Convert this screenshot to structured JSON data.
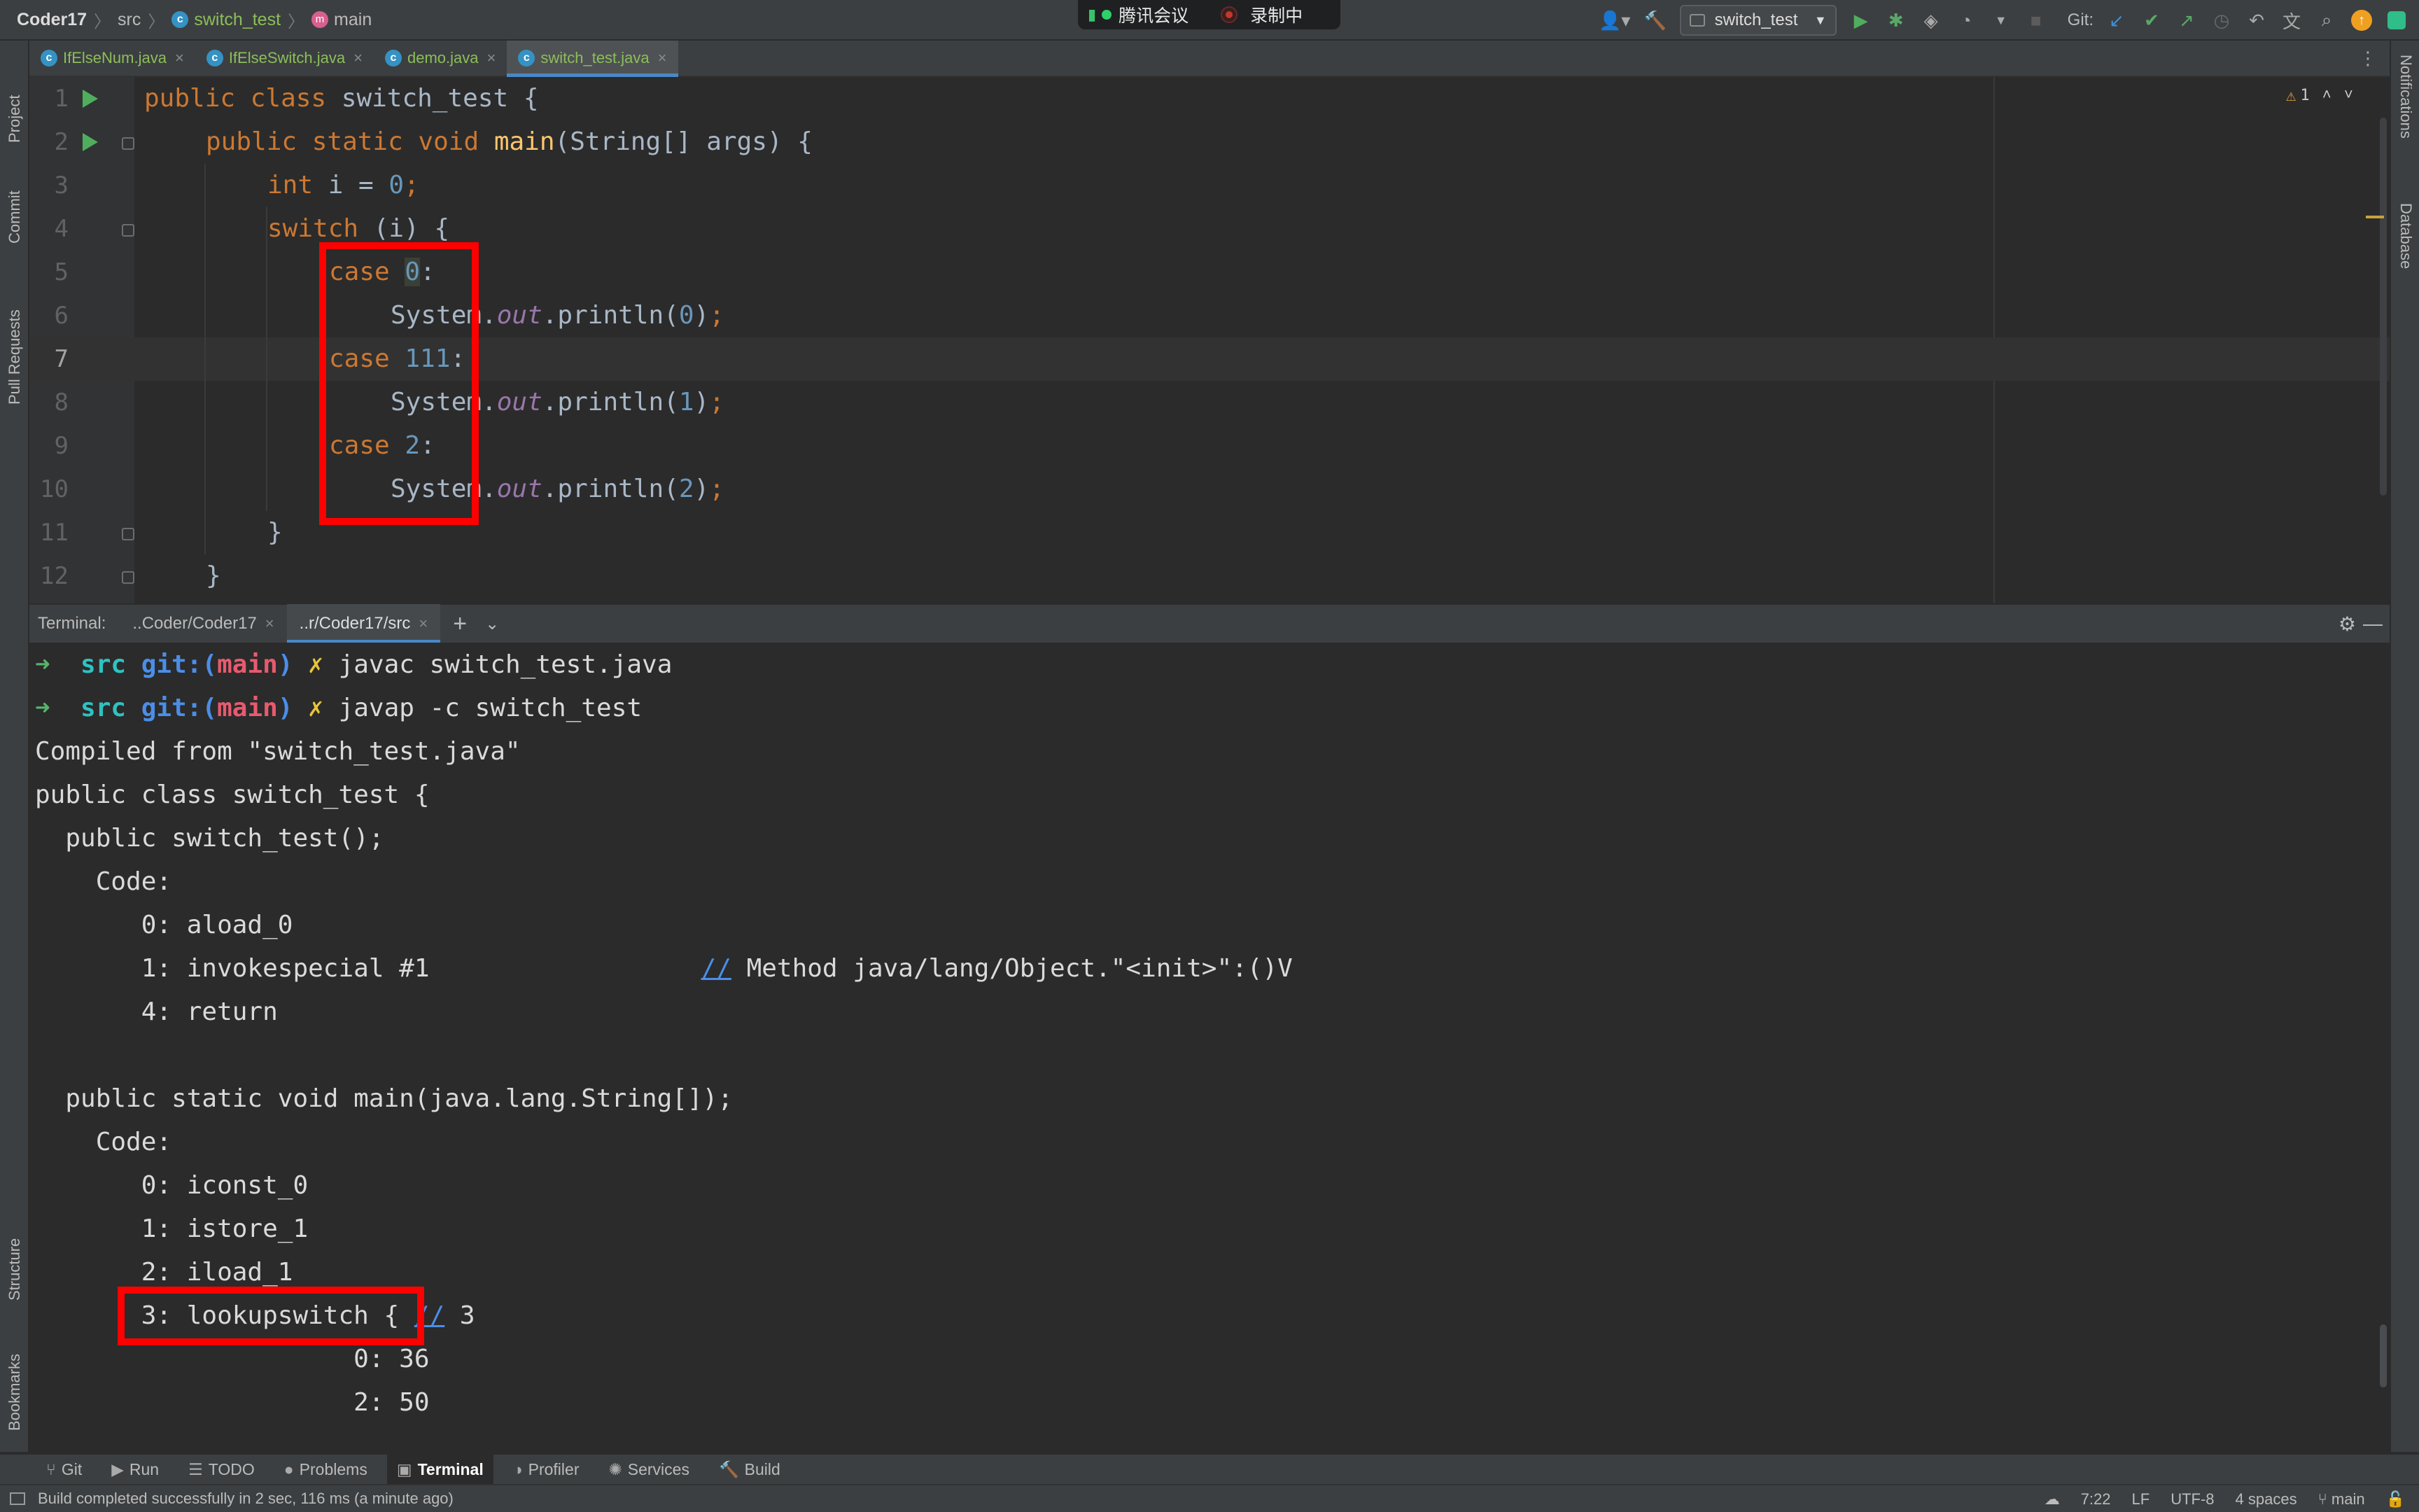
{
  "breadcrumb": {
    "project": "Coder17",
    "folder": "src",
    "class": "switch_test",
    "method": "main"
  },
  "meeting": {
    "app": "腾讯会议",
    "recording": "录制中"
  },
  "toolbar": {
    "run_config": "switch_test",
    "git_label": "Git:"
  },
  "left_strip": {
    "project": "Project",
    "commit": "Commit",
    "pull_requests": "Pull Requests",
    "structure": "Structure",
    "bookmarks": "Bookmarks"
  },
  "right_strip": {
    "notifications": "Notifications",
    "database": "Database"
  },
  "editor_tabs": [
    "IfElseNum.java",
    "IfElseSwitch.java",
    "demo.java",
    "switch_test.java"
  ],
  "editor": {
    "warnings": "1",
    "current_line": 7
  },
  "code_lines": [
    "1",
    "2",
    "3",
    "4",
    "5",
    "6",
    "7",
    "8",
    "9",
    "10",
    "11",
    "12"
  ],
  "terminal": {
    "label": "Terminal:",
    "tabs": [
      "..Coder/Coder17",
      "..r/Coder17/src"
    ],
    "prompt_dir": "src",
    "prompt_git": "git:(",
    "prompt_branch": "main",
    "prompt_close": ")",
    "prompt_mark": "✗",
    "cmd1": "javac switch_test.java",
    "cmd2": "javap -c switch_test",
    "lines": [
      "Compiled from \"switch_test.java\"",
      "public class switch_test {",
      "  public switch_test();",
      "    Code:",
      "       0: aload_0",
      "       1: invokespecial #1",
      "       4: return",
      "",
      "  public static void main(java.lang.String[]);",
      "    Code:",
      "       0: iconst_0",
      "       1: istore_1",
      "       2: iload_1",
      "       3: lookupswitch",
      "                     0: 36",
      "                     2: 50"
    ],
    "comment_slashes": "//",
    "comment_method": " Method java/lang/Object.\"<init>\":()V",
    "lookup_brace": " { ",
    "lookup_count": " 3"
  },
  "tool_windows": [
    "Git",
    "Run",
    "TODO",
    "Problems",
    "Terminal",
    "Profiler",
    "Services",
    "Build"
  ],
  "status": {
    "message": "Build completed successfully in 2 sec, 116 ms (a minute ago)",
    "position": "7:22",
    "line_sep": "LF",
    "encoding": "UTF-8",
    "indent": "4 spaces",
    "branch": "main"
  }
}
